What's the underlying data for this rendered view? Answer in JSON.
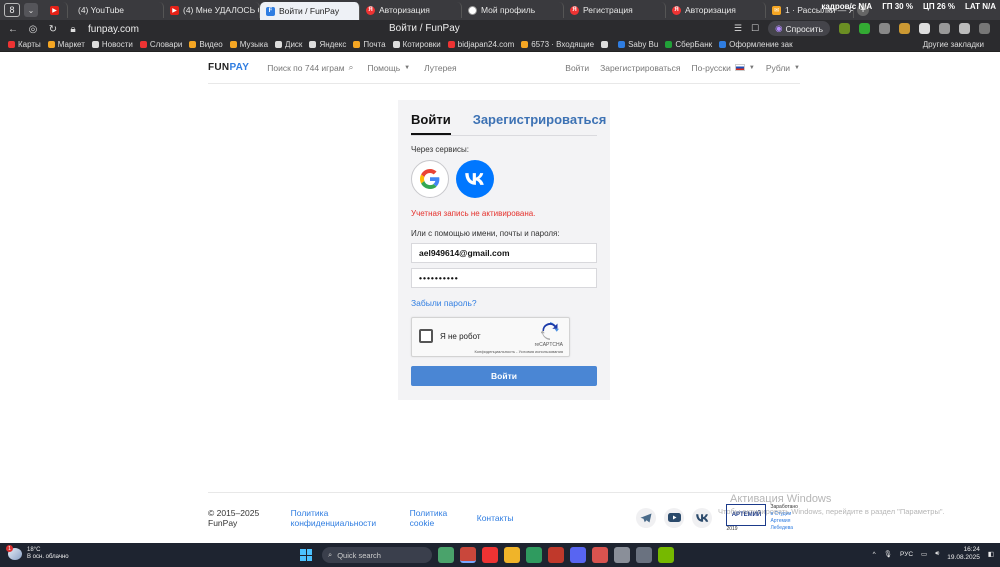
{
  "browser": {
    "tab_count": "8",
    "tabs": [
      {
        "label": "",
        "favicon": "blank"
      },
      {
        "label": "(4) YouTube",
        "favicon": "yt"
      },
      {
        "label": "(4) Мне УДАЛОСЬ Связ",
        "favicon": "yt"
      },
      {
        "label": "Войти / FunPay",
        "favicon": "fp",
        "active": true
      },
      {
        "label": "Авторизация",
        "favicon": "yandex"
      },
      {
        "label": "Мой профиль",
        "favicon": "prof"
      },
      {
        "label": "Регистрация",
        "favicon": "yandex"
      },
      {
        "label": "Авторизация",
        "favicon": "yandex"
      },
      {
        "label": "1 · Рассылки — Яндекс",
        "favicon": "mail"
      }
    ],
    "system_stats": {
      "net": "кадров/с N/A",
      "gpu": "ГП 30 %",
      "cpu": "ЦП 26 %",
      "lat": "LAT N/A"
    },
    "url": "funpay.com",
    "page_title": "Войти / FunPay",
    "ask_label": "Спросить",
    "bookmarks": [
      {
        "label": "Карты",
        "color": "#e33"
      },
      {
        "label": "Маркет",
        "color": "#f5a623"
      },
      {
        "label": "Новости",
        "color": "#ddd"
      },
      {
        "label": "Словари",
        "color": "#e33"
      },
      {
        "label": "Видео",
        "color": "#f5a623"
      },
      {
        "label": "Музыка",
        "color": "#f5a623"
      },
      {
        "label": "Диск",
        "color": "#ddd"
      },
      {
        "label": "Яндекс",
        "color": "#ddd"
      },
      {
        "label": "Почта",
        "color": "#f5a623"
      },
      {
        "label": "Котировки",
        "color": "#ddd"
      },
      {
        "label": "bidjapan24.com",
        "color": "#e33"
      },
      {
        "label": "6573 · Входящие",
        "color": "#f5a623"
      },
      {
        "label": "",
        "color": "#ddd"
      },
      {
        "label": "Saby Bu",
        "color": "#2f7de1"
      },
      {
        "label": "СберБанк",
        "color": "#21a038"
      },
      {
        "label": "Оформление зак",
        "color": "#2f7de1"
      }
    ],
    "other_bookmarks": "Другие закладки"
  },
  "header": {
    "logo_left": "FUN",
    "logo_right": "PAY",
    "search": "Поиск по 744 играм",
    "help": "Помощь",
    "lottery": "Лутерея",
    "login": "Войти",
    "register": "Зарегистрироваться",
    "language": "По-русски",
    "currency": "Рубли"
  },
  "login": {
    "tab_login": "Войти",
    "tab_register": "Зарегистрироваться",
    "services_label": "Через сервисы:",
    "error": "Учетная запись не активирована.",
    "or_label": "Или с помощью имени, почты и пароля:",
    "email_value": "ael949614@gmail.com",
    "password_value": "••••••••••",
    "forgot": "Забыли пароль?",
    "captcha_label": "Я не робот",
    "captcha_brand": "reCAPTCHA",
    "captcha_links": "Конфиденциальность - Условия использования",
    "submit": "Войти"
  },
  "footer": {
    "copyright": "© 2015–2025 FunPay",
    "privacy": "Политика конфиденциальности",
    "cookie": "Политика cookie",
    "contacts": "Контакты",
    "badge_title": "АРТЕМИЙ",
    "badge_year": "2019",
    "badge_line1": "Заработано",
    "badge_line2": "в Студии Артемия",
    "badge_line3": "Лебедева"
  },
  "watermark": {
    "title": "Активация Windows",
    "subtitle": "Чтобы активировать Windows, перейдите в раздел \"Параметры\"."
  },
  "taskbar": {
    "weather_temp": "18°C",
    "weather_desc": "В осн. облачно",
    "weather_badge": "1",
    "search": "Quick search",
    "lang": "РУС",
    "time": "16:24",
    "date": "19.08.2025"
  }
}
